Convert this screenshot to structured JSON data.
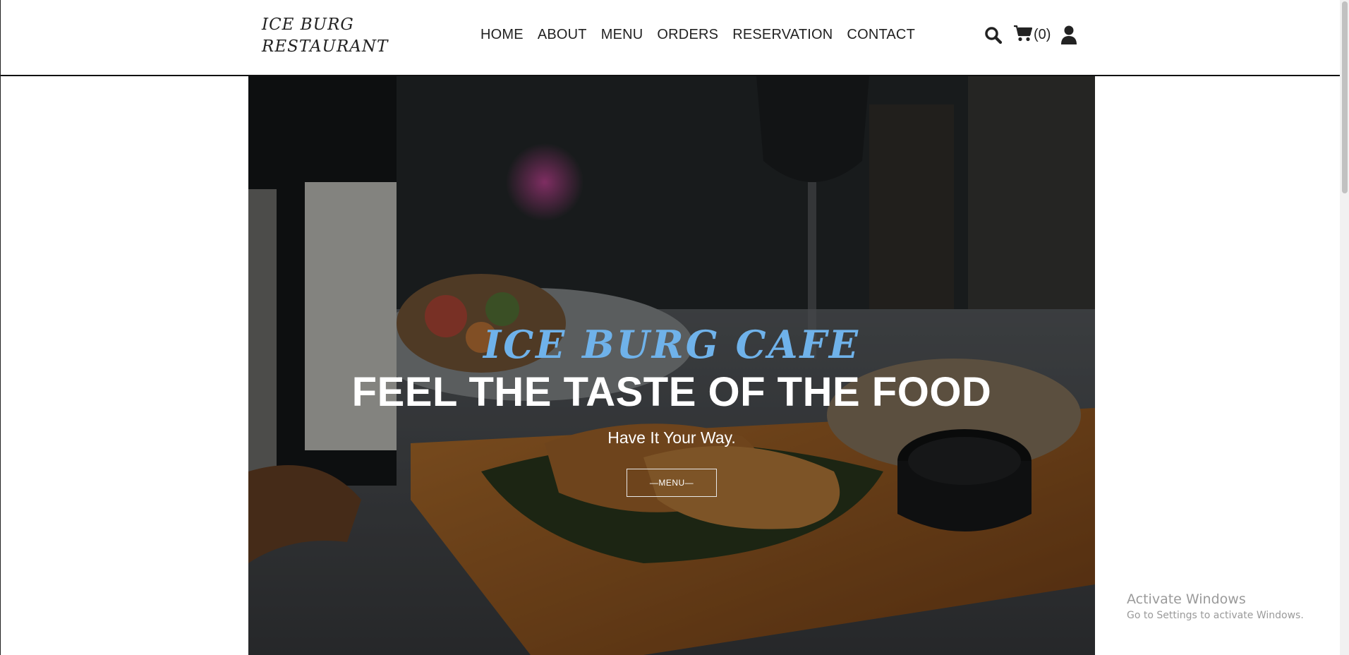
{
  "header": {
    "logo_line1": "ICE BURG",
    "logo_line2": "RESTAURANT",
    "nav": [
      {
        "label": "HOME"
      },
      {
        "label": "ABOUT"
      },
      {
        "label": "MENU"
      },
      {
        "label": "ORDERS"
      },
      {
        "label": "RESERVATION"
      },
      {
        "label": "CONTACT"
      }
    ],
    "cart_count": "(0)",
    "icons": [
      "search-icon",
      "cart-icon",
      "user-icon"
    ]
  },
  "hero": {
    "subtitle": "ICE BURG CAFE",
    "title": "FEEL THE TASTE OF THE FOOD",
    "tagline": "Have It Your Way.",
    "button_label": "—MENU—"
  },
  "watermark": {
    "title": "Activate Windows",
    "subtitle": "Go to Settings to activate Windows."
  },
  "colors": {
    "accent": "#6fb2ea",
    "text": "#222222",
    "hero_text": "#ffffff"
  }
}
